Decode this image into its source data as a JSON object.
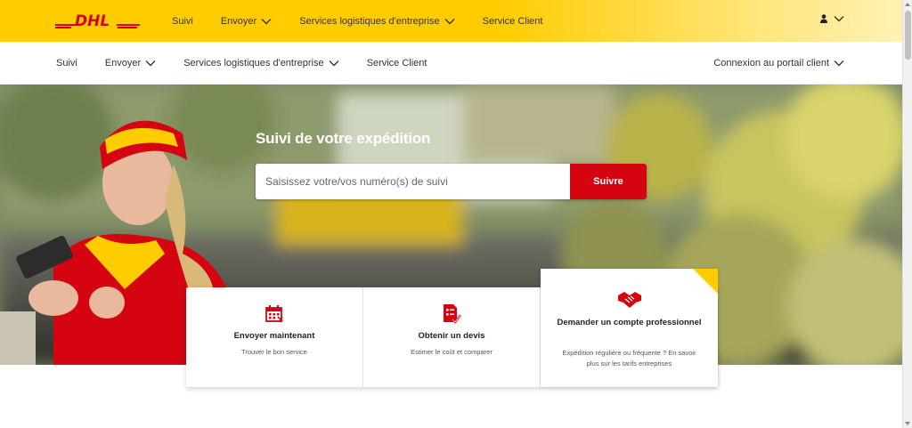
{
  "brand": {
    "logo_text": "DHL",
    "yellow": "#ffcc00",
    "red": "#d40511"
  },
  "topnav": {
    "items": [
      {
        "label": "Suivi",
        "has_dropdown": false
      },
      {
        "label": "Envoyer",
        "has_dropdown": true
      },
      {
        "label": "Services logistiques d'entreprise",
        "has_dropdown": true
      },
      {
        "label": "Service Client",
        "has_dropdown": false
      }
    ],
    "user_icon": "user-icon"
  },
  "subnav": {
    "items": [
      {
        "label": "Suivi",
        "has_dropdown": false
      },
      {
        "label": "Envoyer",
        "has_dropdown": true
      },
      {
        "label": "Services logistiques d'entreprise",
        "has_dropdown": true
      },
      {
        "label": "Service Client",
        "has_dropdown": false
      }
    ],
    "portal_label": "Connexion au portail client"
  },
  "hero": {
    "title": "Suivi de votre expédition",
    "search_placeholder": "Saisissez votre/vos numéro(s) de suivi",
    "search_button": "Suivre"
  },
  "cards": [
    {
      "icon": "calendar-icon",
      "title": "Envoyer maintenant",
      "subtitle": "Trouver le bon service"
    },
    {
      "icon": "quote-document-icon",
      "title": "Obtenir un devis",
      "subtitle": "Estimer le coût et comparer"
    },
    {
      "icon": "handshake-icon",
      "title": "Demander un compte professionnel",
      "subtitle": "Expédition régulière ou fréquente ? En savoir plus sur les tarifs entreprises"
    }
  ]
}
